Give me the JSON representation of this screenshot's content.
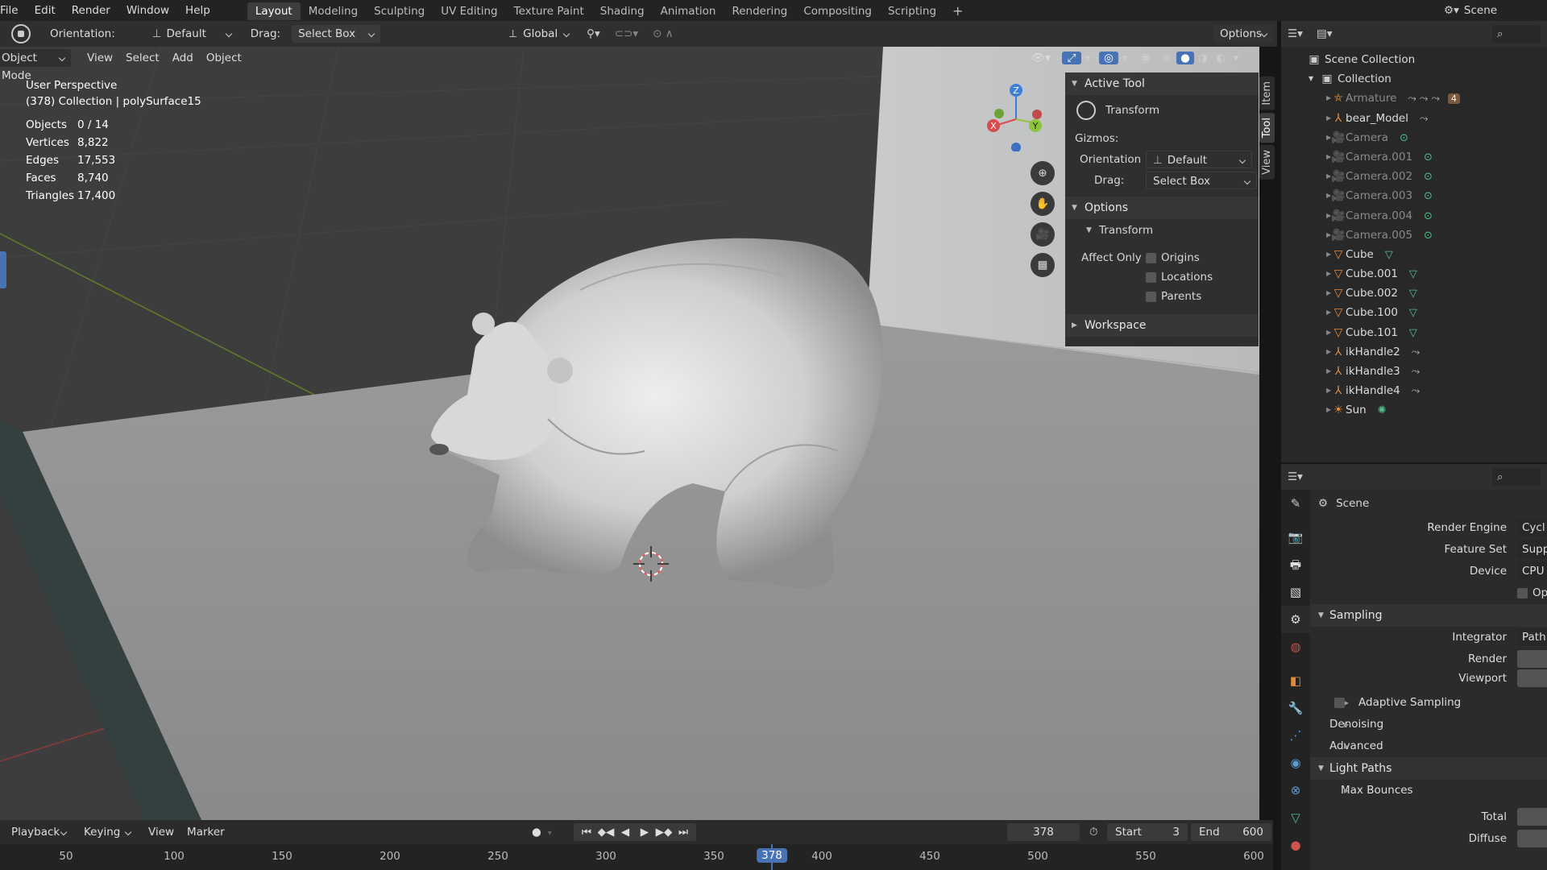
{
  "menu": [
    "File",
    "Edit",
    "Render",
    "Window",
    "Help"
  ],
  "workspaces": [
    {
      "label": "Layout",
      "active": true
    },
    {
      "label": "Modeling"
    },
    {
      "label": "Sculpting"
    },
    {
      "label": "UV Editing"
    },
    {
      "label": "Texture Paint"
    },
    {
      "label": "Shading"
    },
    {
      "label": "Animation"
    },
    {
      "label": "Rendering"
    },
    {
      "label": "Compositing"
    },
    {
      "label": "Scripting"
    }
  ],
  "add_workspace": "+",
  "scene_name": "Scene",
  "header": {
    "orientation_label": "Orientation:",
    "orientation_value": "Default",
    "drag_label": "Drag:",
    "drag_value": "Select Box",
    "transform_space": "Global",
    "options": "Options"
  },
  "viewport_header": {
    "mode": "Object Mode",
    "view": "View",
    "select": "Select",
    "add": "Add",
    "object": "Object"
  },
  "viewport_info": {
    "perspective": "User Perspective",
    "collection": "(378) Collection | polySurface15",
    "stats": [
      {
        "label": "Objects",
        "value": "0 / 14"
      },
      {
        "label": "Vertices",
        "value": "8,822"
      },
      {
        "label": "Edges",
        "value": "17,553"
      },
      {
        "label": "Faces",
        "value": "8,740"
      },
      {
        "label": "Triangles",
        "value": "17,400"
      }
    ]
  },
  "gizmo": {
    "x": "X",
    "y": "Y",
    "z": "Z"
  },
  "npanel": {
    "tabs": [
      "Item",
      "Tool",
      "View"
    ],
    "active_tool": "Active Tool",
    "tool_name": "Transform",
    "gizmos": "Gizmos:",
    "orientation_label": "Orientation",
    "orientation_value": "Default",
    "drag_label": "Drag:",
    "drag_value": "Select Box",
    "options": "Options",
    "transform": "Transform",
    "affect_only": "Affect Only",
    "origins": "Origins",
    "locations": "Locations",
    "parents": "Parents",
    "workspace": "Workspace"
  },
  "outliner": {
    "scene_collection": "Scene Collection",
    "collection": "Collection",
    "items": [
      {
        "name": "Armature",
        "icon": "armature",
        "dim": true
      },
      {
        "name": "bear_Model",
        "icon": "bone",
        "dim": false
      },
      {
        "name": "Camera",
        "icon": "camera",
        "dim": true
      },
      {
        "name": "Camera.001",
        "icon": "camera",
        "dim": true
      },
      {
        "name": "Camera.002",
        "icon": "camera",
        "dim": true
      },
      {
        "name": "Camera.003",
        "icon": "camera",
        "dim": true
      },
      {
        "name": "Camera.004",
        "icon": "camera",
        "dim": true
      },
      {
        "name": "Camera.005",
        "icon": "camera",
        "dim": true
      },
      {
        "name": "Cube",
        "icon": "mesh",
        "dim": false
      },
      {
        "name": "Cube.001",
        "icon": "mesh",
        "dim": false
      },
      {
        "name": "Cube.002",
        "icon": "mesh",
        "dim": false
      },
      {
        "name": "Cube.100",
        "icon": "mesh",
        "dim": false
      },
      {
        "name": "Cube.101",
        "icon": "mesh",
        "dim": false
      },
      {
        "name": "ikHandle2",
        "icon": "bone",
        "dim": false
      },
      {
        "name": "ikHandle3",
        "icon": "bone",
        "dim": false
      },
      {
        "name": "ikHandle4",
        "icon": "bone",
        "dim": false
      },
      {
        "name": "Sun",
        "icon": "light",
        "dim": false
      }
    ],
    "armature_badge": "4"
  },
  "properties": {
    "title": "Scene",
    "render_engine_label": "Render Engine",
    "render_engine_value": "Cycl",
    "feature_set_label": "Feature Set",
    "feature_set_value": "Supp",
    "device_label": "Device",
    "device_value": "CPU",
    "open_label": "Op",
    "sampling": "Sampling",
    "integrator_label": "Integrator",
    "integrator_value": "Path",
    "render_label": "Render",
    "viewport_label": "Viewport",
    "adaptive": "Adaptive Sampling",
    "denoising": "Denoising",
    "advanced": "Advanced",
    "light_paths": "Light Paths",
    "max_bounces": "Max Bounces",
    "total_label": "Total",
    "diffuse_label": "Diffuse"
  },
  "timeline": {
    "playback": "Playback",
    "keying": "Keying",
    "view": "View",
    "marker": "Marker",
    "current_frame": "378",
    "start_label": "Start",
    "start": "3",
    "end_label": "End",
    "end": "600",
    "ticks": [
      "50",
      "100",
      "150",
      "200",
      "250",
      "300",
      "350",
      "378",
      "400",
      "450",
      "500",
      "550",
      "600"
    ]
  },
  "colors": {
    "accent": "#4772b3",
    "orange": "#e58a3a",
    "green": "#4fc28e"
  }
}
